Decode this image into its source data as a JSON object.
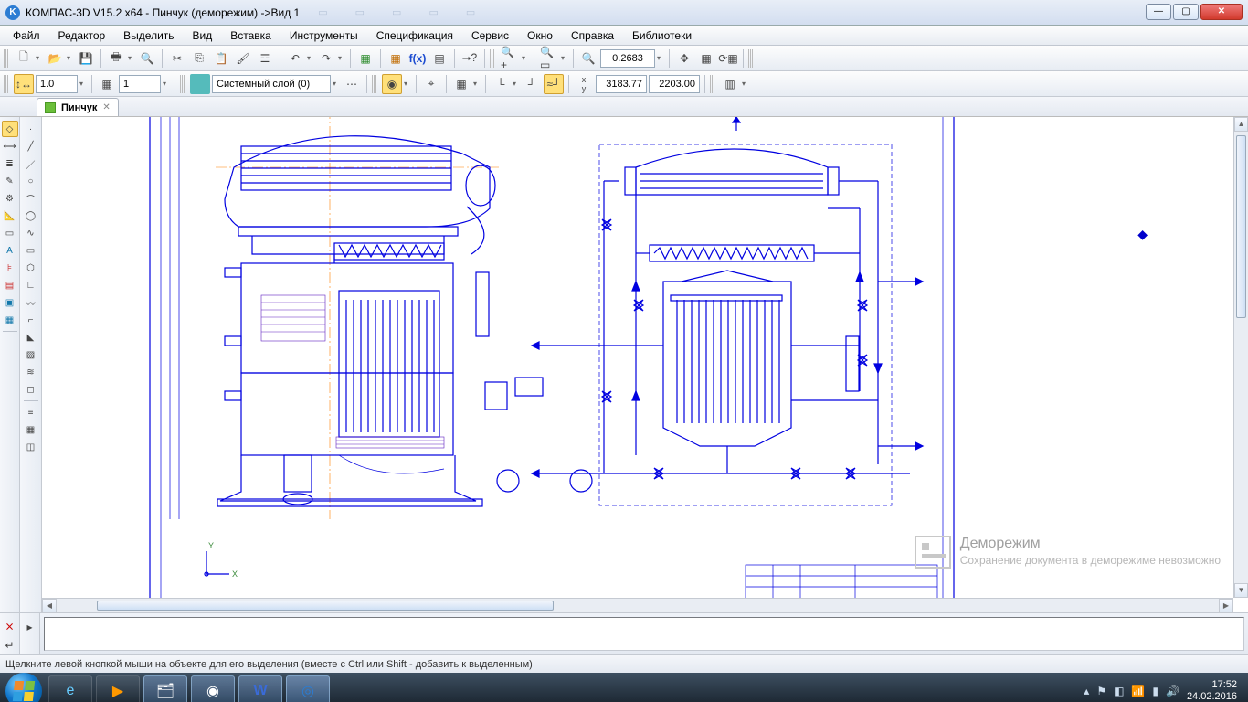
{
  "title": "КОМПАС-3D V15.2  x64 - Пинчук (деморежим) ->Вид 1",
  "menu": {
    "file": "Файл",
    "editor": "Редактор",
    "select": "Выделить",
    "view": "Вид",
    "insert": "Вставка",
    "tools": "Инструменты",
    "spec": "Спецификация",
    "service": "Сервис",
    "window": "Окно",
    "help": "Справка",
    "libs": "Библиотеки"
  },
  "toolbar1": {
    "zoom_value": "0.2683"
  },
  "toolbar2": {
    "scale": "1.0",
    "step": "1",
    "layer": "Системный слой (0)",
    "coord_x": "3183.77",
    "coord_y": "2203.00"
  },
  "doc_tab": {
    "name": "Пинчук"
  },
  "watermark": {
    "title": "Деморежим",
    "text": "Сохранение документа в деморежиме невозможно"
  },
  "statusbar": {
    "hint": "Щелкните левой кнопкой мыши на объекте для его выделения (вместе с Ctrl или Shift - добавить к выделенным)"
  },
  "taskbar": {
    "time": "17:52",
    "date": "24.02.2016"
  }
}
